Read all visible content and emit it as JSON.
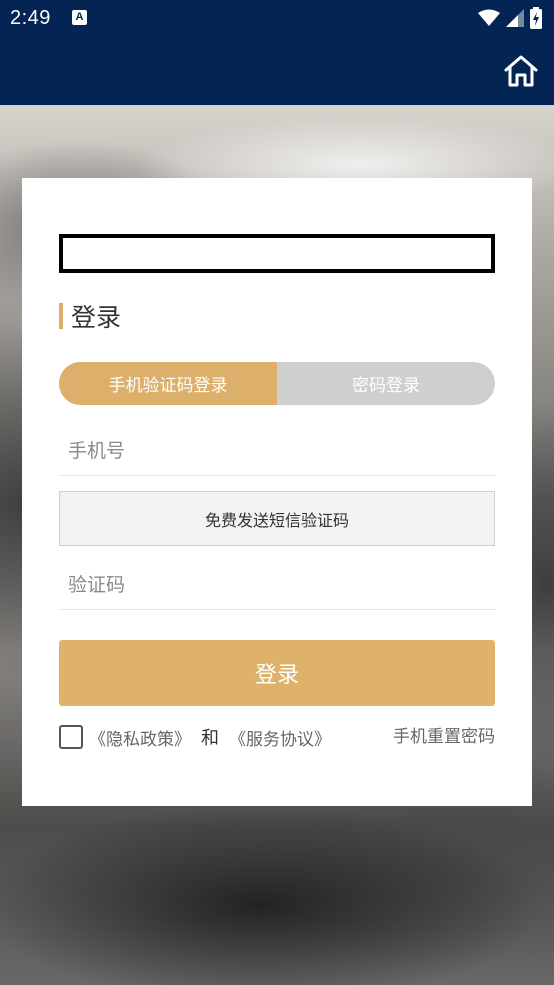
{
  "status_bar": {
    "time": "2:49",
    "notification_icon": "A"
  },
  "app_bar": {
    "home_icon": "home-icon"
  },
  "login": {
    "title": "登录",
    "tabs": [
      {
        "label": "手机验证码登录",
        "active": true
      },
      {
        "label": "密码登录",
        "active": false
      }
    ],
    "phone_placeholder": "手机号",
    "sms_button": "免费发送短信验证码",
    "code_placeholder": "验证码",
    "login_button": "登录",
    "privacy_link": "《隐私政策》",
    "and_text": "和",
    "service_link": "《服务协议》",
    "reset_link": "手机重置密码"
  },
  "colors": {
    "header": "#042454",
    "accent": "#dcb06a",
    "inactive_tab": "#cfcfcf"
  }
}
